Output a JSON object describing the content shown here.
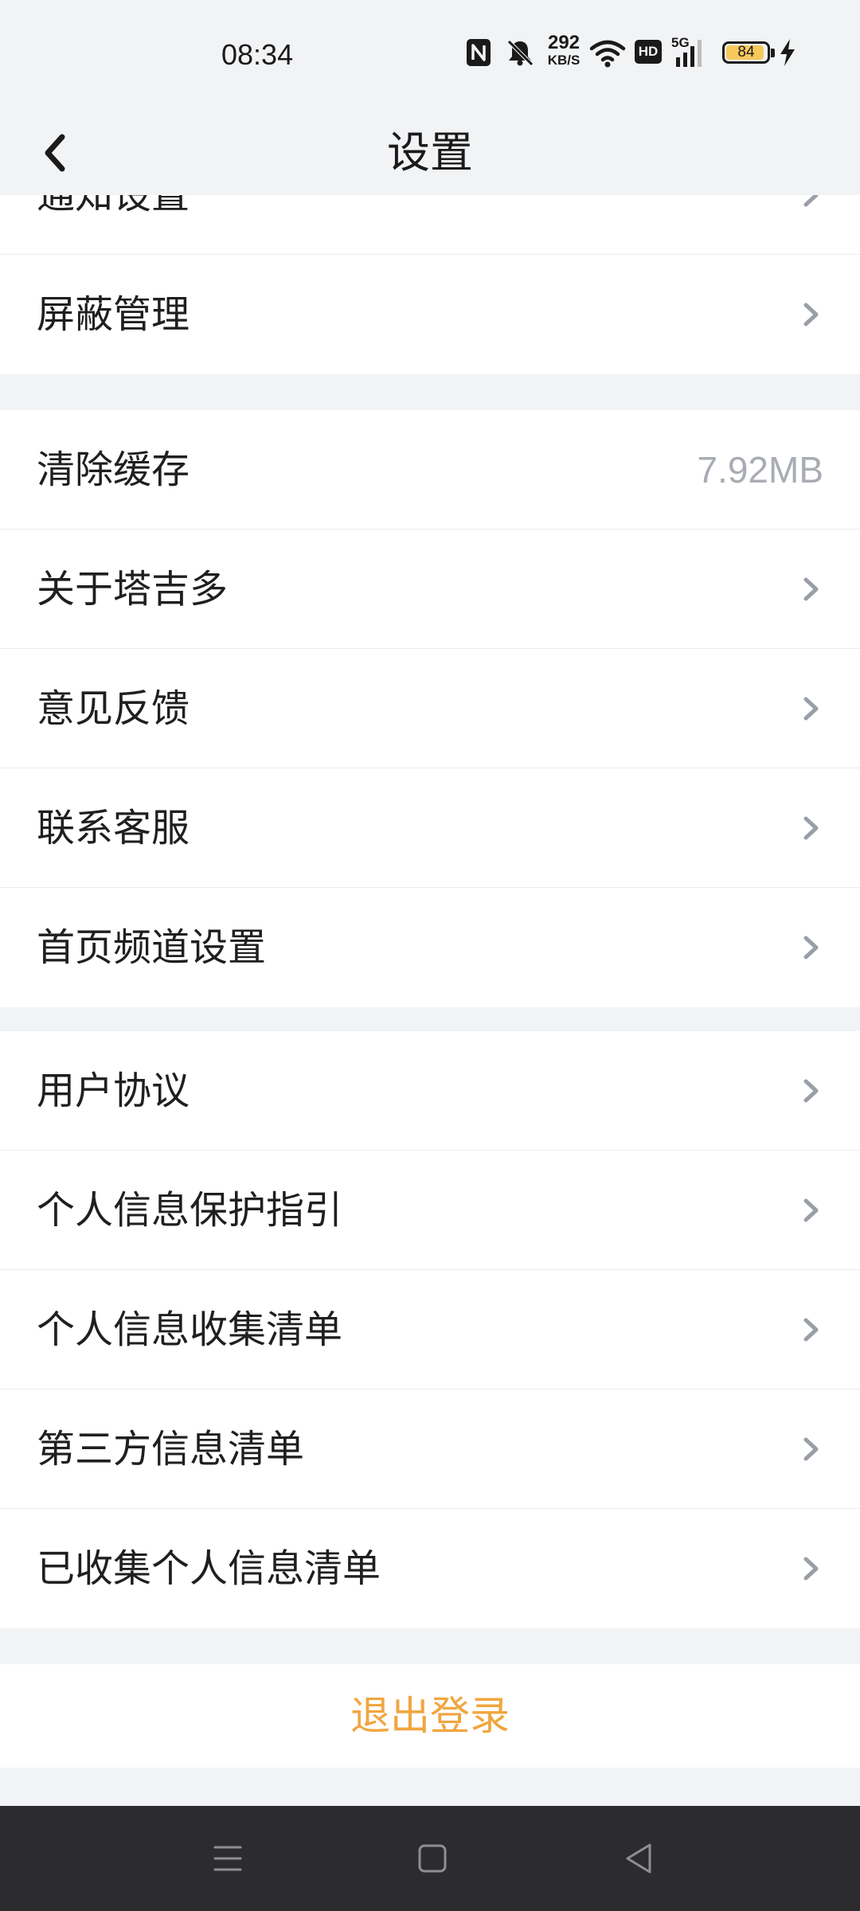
{
  "status_bar": {
    "time": "08:34",
    "net_speed_value": "292",
    "net_speed_unit": "KB/S",
    "hd_label": "HD",
    "network_label": "5G",
    "battery_level": "84",
    "icons": [
      "nfc-icon",
      "bell-mute-icon",
      "wifi-icon",
      "hd-icon",
      "signal-icon",
      "battery-icon",
      "charging-icon"
    ]
  },
  "header": {
    "title": "设置",
    "back_icon": "chevron-left-icon"
  },
  "groups": {
    "top": [
      {
        "label": "通知设置"
      },
      {
        "label": "屏蔽管理"
      }
    ],
    "middle": [
      {
        "label": "清除缓存",
        "value": "7.92MB"
      },
      {
        "label": "关于塔吉多"
      },
      {
        "label": "意见反馈"
      },
      {
        "label": "联系客服"
      },
      {
        "label": "首页频道设置"
      }
    ],
    "bottom": [
      {
        "label": "用户协议"
      },
      {
        "label": "个人信息保护指引"
      },
      {
        "label": "个人信息收集清单"
      },
      {
        "label": "第三方信息清单"
      },
      {
        "label": "已收集个人信息清单"
      }
    ]
  },
  "logout_label": "退出登录",
  "colors": {
    "background": "#f2f3f5",
    "accent": "#f0a640",
    "secondary_text": "#a8acb3",
    "nav_bar": "#2c2c2e"
  },
  "nav_bar": {
    "icons": [
      "menu-icon",
      "home-icon",
      "back-triangle-icon"
    ]
  }
}
